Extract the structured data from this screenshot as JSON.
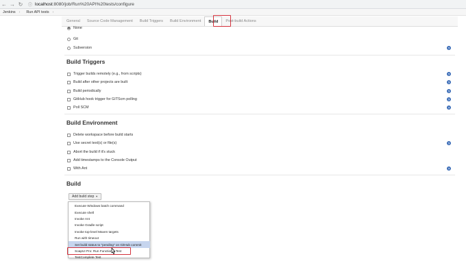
{
  "browser": {
    "url_host": "localhost",
    "url_path": ":8080/job/Run%20API%20tests/configure"
  },
  "breadcrumbs": [
    {
      "label": "Jenkins"
    },
    {
      "label": "Run API tests"
    }
  ],
  "tabs": [
    {
      "label": "General"
    },
    {
      "label": "Source Code Management"
    },
    {
      "label": "Build Triggers"
    },
    {
      "label": "Build Environment"
    },
    {
      "label": "Build",
      "active": true
    },
    {
      "label": "Post-build Actions"
    }
  ],
  "scm": {
    "options": [
      {
        "label": "None",
        "selected": true
      },
      {
        "label": "Git",
        "selected": false
      },
      {
        "label": "Subversion",
        "selected": false
      }
    ]
  },
  "build_triggers": {
    "title": "Build Triggers",
    "options": [
      {
        "label": "Trigger builds remotely (e.g., from scripts)",
        "checked": false
      },
      {
        "label": "Build after other projects are built",
        "checked": false
      },
      {
        "label": "Build periodically",
        "checked": false
      },
      {
        "label": "GitHub hook trigger for GITScm polling",
        "checked": false
      },
      {
        "label": "Poll SCM",
        "checked": false
      }
    ]
  },
  "build_environment": {
    "title": "Build Environment",
    "options": [
      {
        "label": "Delete workspace before build starts",
        "checked": false
      },
      {
        "label": "Use secret text(s) or file(s)",
        "checked": false
      },
      {
        "label": "Abort the build if it's stuck",
        "checked": false
      },
      {
        "label": "Add timestamps to the Console Output",
        "checked": false
      },
      {
        "label": "With Ant",
        "checked": false
      }
    ]
  },
  "build": {
    "title": "Build",
    "add_step_label": "Add build step",
    "dropdown_items": [
      {
        "label": "Execute Windows batch command"
      },
      {
        "label": "Execute shell"
      },
      {
        "label": "Invoke Ant"
      },
      {
        "label": "Invoke Gradle script"
      },
      {
        "label": "Invoke top-level Maven targets"
      },
      {
        "label": "Run with timeout"
      },
      {
        "label": "Set build status to \"pending\" on GitHub commit"
      },
      {
        "label": "SoapUI Pro: Run Functional Test"
      },
      {
        "label": "TestComplete Test"
      }
    ]
  },
  "help_icon_glyph": "?",
  "colors": {
    "highlight_box": "#d32f3a",
    "help_icon": "#3b6cb7",
    "dropdown_hover": "#c6d5ee"
  }
}
